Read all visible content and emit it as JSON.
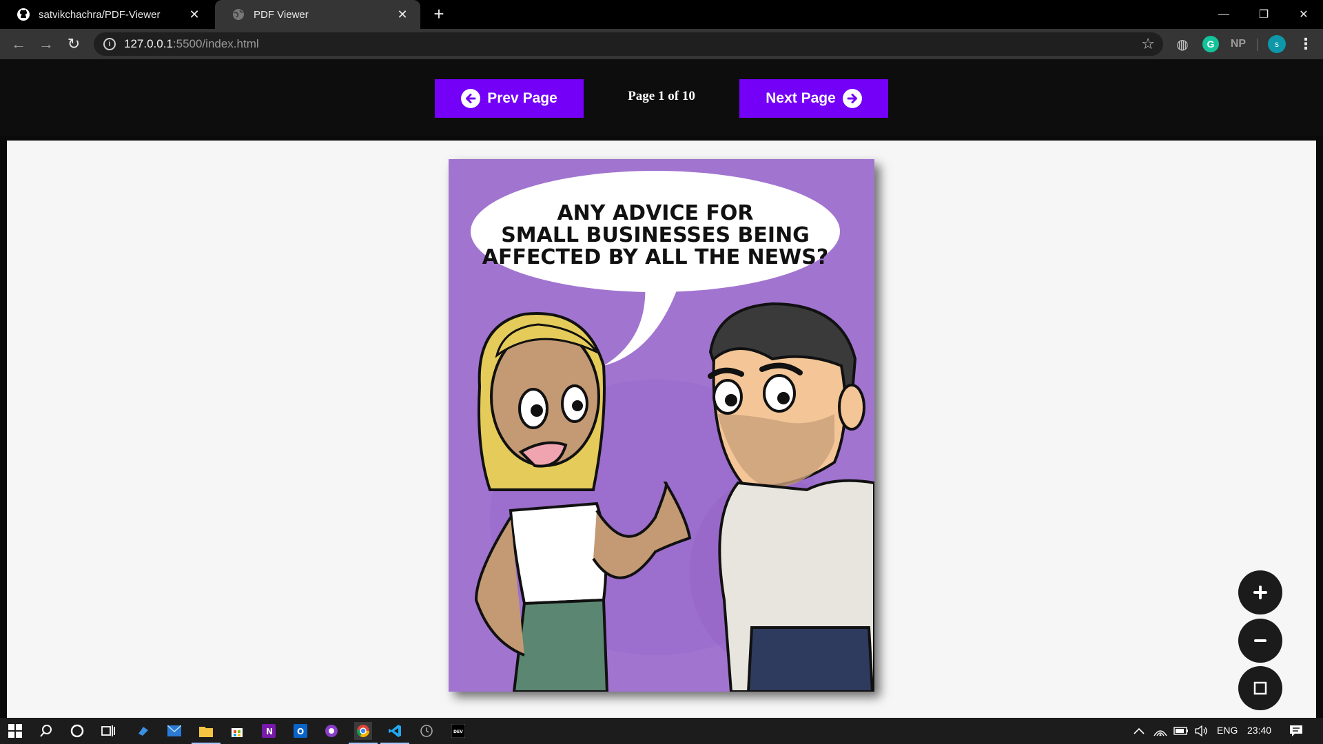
{
  "browser": {
    "tabs": [
      {
        "title": "satvikchachra/PDF-Viewer",
        "icon": "github-icon"
      },
      {
        "title": "PDF Viewer",
        "icon": "globe-icon"
      }
    ],
    "url_host": "127.0.0.1",
    "url_path": ":5500/index.html",
    "extensions": {
      "grammarly": "G",
      "np": "NP",
      "avatar_letter": "s"
    }
  },
  "viewer": {
    "prev_label": "Prev Page",
    "next_label": "Next Page",
    "page_prefix": "Page",
    "current_page": "1",
    "page_sep": "of",
    "total_pages": "10",
    "comic_text": [
      "ANY ADVICE FOR",
      "SMALL BUSINESSES BEING",
      "AFFECTED BY ALL THE NEWS?"
    ],
    "zoom_buttons": [
      "zoom-in",
      "zoom-out",
      "fit-page"
    ],
    "colors": {
      "accent": "#7400f7",
      "page_bg": "#a174d0"
    }
  },
  "taskbar": {
    "lang": "ENG",
    "time": "23:40",
    "apps": [
      "start-icon",
      "search-icon",
      "cortana-icon",
      "task-view-icon",
      "people-icon",
      "mail-icon",
      "file-explorer-icon",
      "store-icon",
      "onenote-icon",
      "outlook-icon",
      "podcast-icon",
      "chrome-icon",
      "vscode-icon",
      "clock-icon",
      "dev-icon"
    ]
  }
}
